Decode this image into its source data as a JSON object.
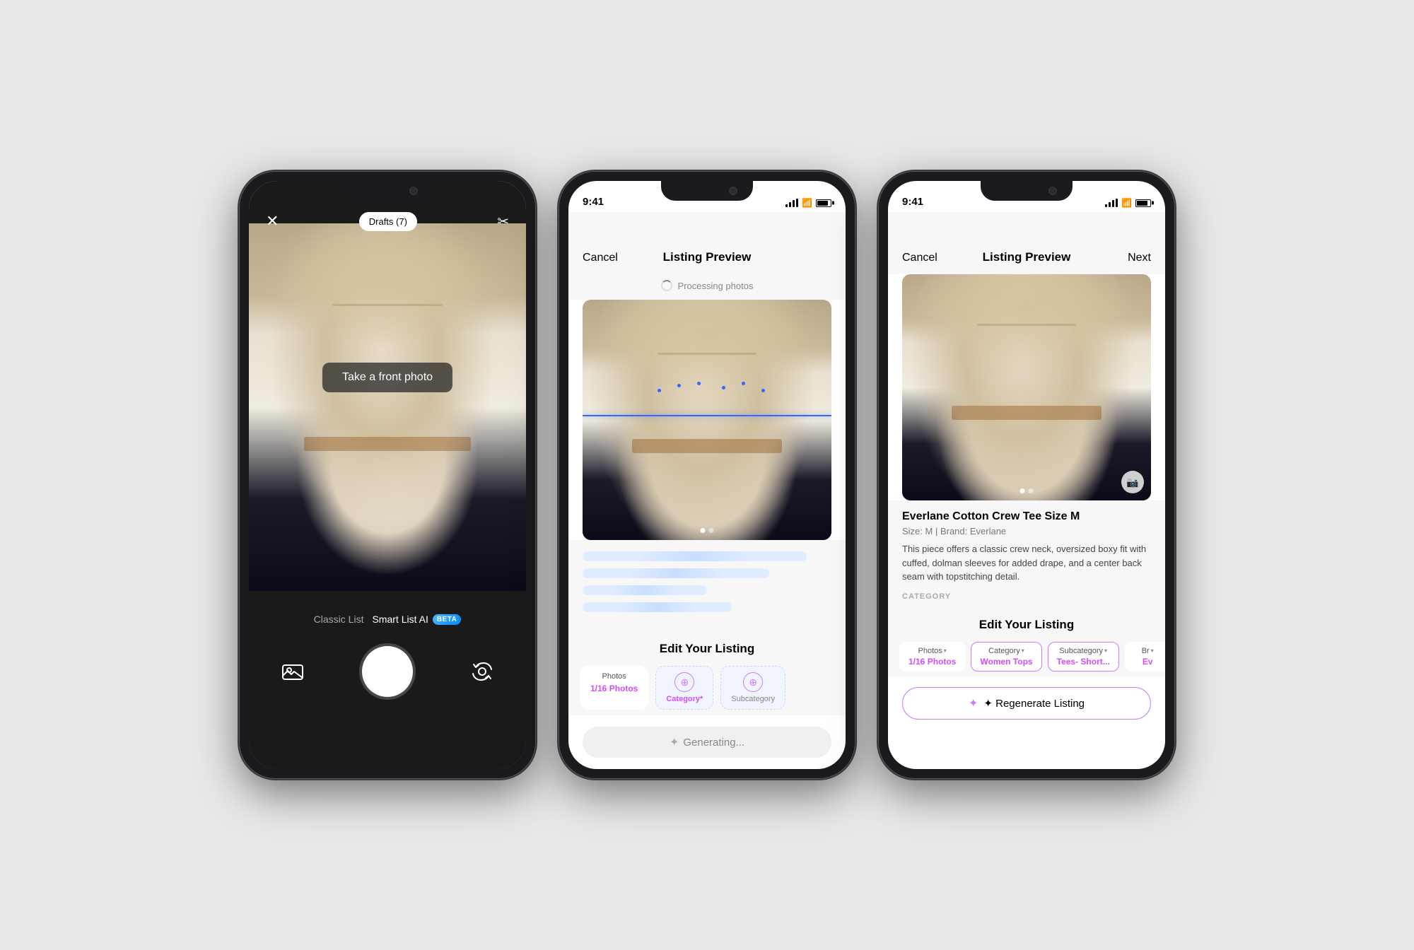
{
  "phones": [
    {
      "id": "phone-1",
      "type": "camera",
      "screen_bg": "dark",
      "header": {
        "close_label": "✕",
        "draft_label": "Drafts (7)",
        "scissors_label": "✂"
      },
      "photo_overlay": "Take a front photo",
      "mode_switcher": {
        "classic_label": "Classic List",
        "smart_label": "Smart List AI",
        "beta_label": "BETA"
      },
      "controls": {
        "gallery_icon": "🖼",
        "flip_icon": "↺"
      }
    },
    {
      "id": "phone-2",
      "type": "processing",
      "status_time": "9:41",
      "header": {
        "cancel_label": "Cancel",
        "title": "Listing Preview",
        "next_label": ""
      },
      "processing_label": "Processing photos",
      "skeleton_lines": [
        {
          "width": "88%"
        },
        {
          "width": "75%"
        },
        {
          "width": "55%"
        },
        {
          "width": "65%"
        }
      ],
      "edit_section": {
        "title": "Edit Your Listing",
        "tabs": [
          {
            "top": "Photos",
            "bottom": "1/16 Photos",
            "type": "normal"
          },
          {
            "top": "",
            "bottom": "Category*",
            "type": "selected",
            "icon": "⊕"
          },
          {
            "top": "",
            "bottom": "Subcategory",
            "type": "selected",
            "icon": "⊕"
          }
        ]
      },
      "generating_label": "Generating..."
    },
    {
      "id": "phone-3",
      "type": "complete",
      "status_time": "9:41",
      "header": {
        "cancel_label": "Cancel",
        "title": "Listing Preview",
        "next_label": "Next"
      },
      "listing": {
        "title": "Everlane Cotton Crew Tee Size M",
        "meta": "Size: M  |  Brand: Everlane",
        "description": "This piece offers a classic crew neck, oversized boxy fit with cuffed, dolman sleeves for added drape, and a center back seam with topstitching detail.",
        "category_label": "CATEGORY"
      },
      "edit_section": {
        "title": "Edit Your Listing",
        "tabs": [
          {
            "top": "Photos",
            "bottom": "1/16 Photos",
            "type": "normal"
          },
          {
            "top": "Category",
            "bottom": "Women Tops",
            "type": "selected"
          },
          {
            "top": "Subcategory",
            "bottom": "Tees- Short...",
            "type": "selected"
          },
          {
            "top": "Br",
            "bottom": "Ev",
            "type": "normal"
          }
        ]
      },
      "regenerate_label": "✦ Regenerate Listing"
    }
  ]
}
